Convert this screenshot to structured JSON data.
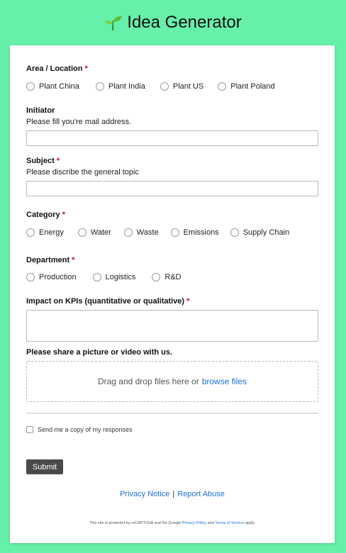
{
  "header": {
    "title": "Idea Generator",
    "icon": "sprout-icon"
  },
  "form": {
    "area": {
      "label": "Area / Location",
      "required_mark": "*",
      "options": [
        "Plant China",
        "Plant India",
        "Plant US",
        "Plant Poland"
      ]
    },
    "initiator": {
      "label": "Initiator",
      "help": "Please fill you're mail address.",
      "value": ""
    },
    "subject": {
      "label": "Subject",
      "required_mark": "*",
      "help": "Please discribe the general topic",
      "value": ""
    },
    "category": {
      "label": "Category",
      "required_mark": "*",
      "options": [
        "Energy",
        "Water",
        "Waste",
        "Emissions",
        "Supply Chain"
      ]
    },
    "department": {
      "label": "Department",
      "required_mark": "*",
      "options": [
        "Production",
        "Logistics",
        "R&D"
      ]
    },
    "impact": {
      "label": "Impact on KPIs (quantitative or qualitative)",
      "required_mark": "*",
      "value": ""
    },
    "upload": {
      "label": "Please share a picture or video with us.",
      "drop_text": "Drag and drop files here or",
      "browse_text": "browse files"
    },
    "copy_checkbox": {
      "label": "Send me a copy of my responses",
      "checked": false
    },
    "submit_label": "Submit"
  },
  "footer": {
    "privacy_notice": "Privacy Notice",
    "separator": "|",
    "report_abuse": "Report Abuse",
    "recaptcha_prefix": "This site is protected by reCAPTCHA and the Google",
    "privacy_policy": "Privacy Policy",
    "recaptcha_and": "and",
    "terms_of_service": "Terms of Service",
    "recaptcha_suffix": "apply."
  },
  "colors": {
    "background": "#66f0a9",
    "required": "#d0021b",
    "link": "#1a6fd6",
    "submit_button": "#4a4a4a"
  }
}
